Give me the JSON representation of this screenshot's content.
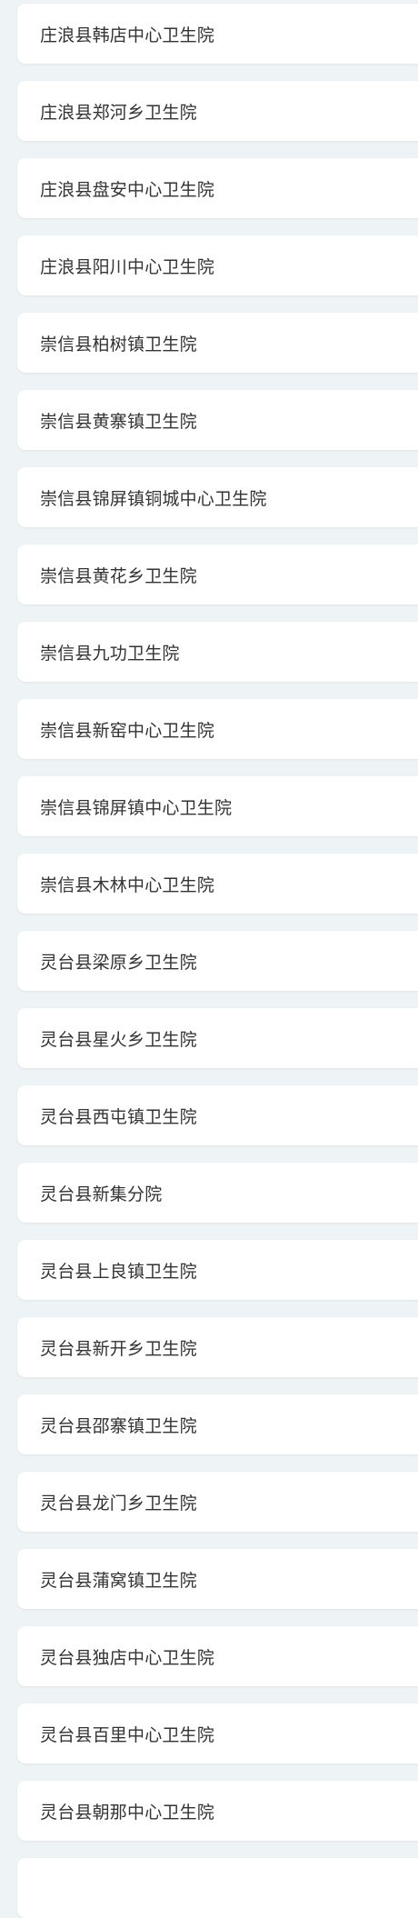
{
  "hospital_list": {
    "items": [
      "庄浪县韩店中心卫生院",
      "庄浪县郑河乡卫生院",
      "庄浪县盘安中心卫生院",
      "庄浪县阳川中心卫生院",
      "崇信县柏树镇卫生院",
      "崇信县黄寨镇卫生院",
      "崇信县锦屏镇铜城中心卫生院",
      "崇信县黄花乡卫生院",
      "崇信县九功卫生院",
      "崇信县新窑中心卫生院",
      "崇信县锦屏镇中心卫生院",
      "崇信县木林中心卫生院",
      "灵台县梁原乡卫生院",
      "灵台县星火乡卫生院",
      "灵台县西屯镇卫生院",
      "灵台县新集分院",
      "灵台县上良镇卫生院",
      "灵台县新开乡卫生院",
      "灵台县邵寨镇卫生院",
      "灵台县龙门乡卫生院",
      "灵台县蒲窝镇卫生院",
      "灵台县独店中心卫生院",
      "灵台县百里中心卫生院",
      "灵台县朝那中心卫生院"
    ]
  }
}
